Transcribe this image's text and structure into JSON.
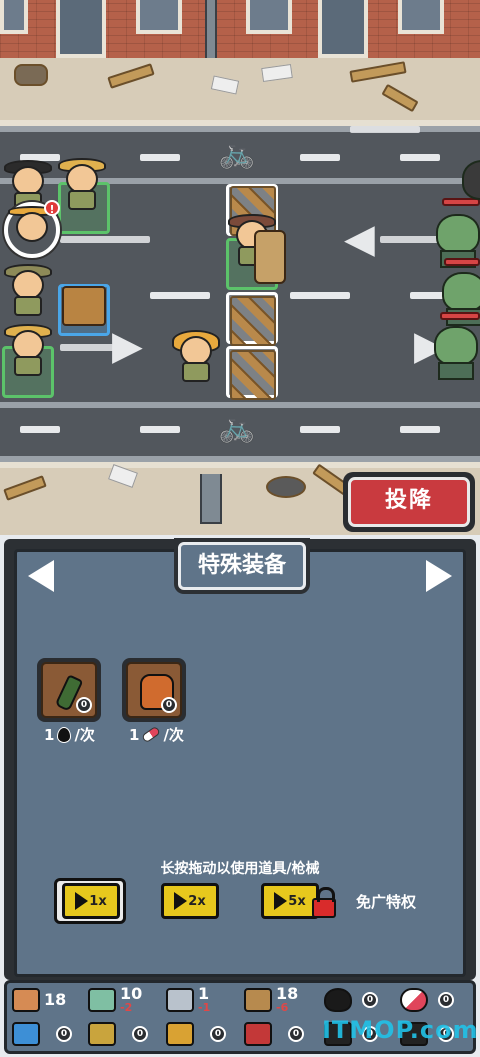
{
  "battle": {
    "surrender_label": "投降"
  },
  "panel": {
    "title": "特殊装备",
    "items": [
      {
        "name": "molotov-bottle",
        "count": "0",
        "cost_amount": "1",
        "cost_unit": "/次",
        "cost_icon": "oil-drop-icon"
      },
      {
        "name": "explosive-backpack",
        "count": "0",
        "cost_amount": "1",
        "cost_unit": "/次",
        "cost_icon": "pill-capsule-icon"
      }
    ],
    "hint": "长按拖动以使用道具/枪械",
    "speed_buttons": [
      {
        "label": "1x",
        "selected": true
      },
      {
        "label": "2x",
        "selected": false
      },
      {
        "label": "5x",
        "locked": true
      }
    ],
    "ad_free_label": "免广特权"
  },
  "resources": {
    "row1": [
      {
        "icon": "meat-icon",
        "value": "18",
        "delta": "",
        "color": "#d68b54"
      },
      {
        "icon": "cloth-bandage-icon",
        "value": "10",
        "delta": "-2",
        "color": "#7fbfa3"
      },
      {
        "icon": "metal-ingot-icon",
        "value": "1",
        "delta": "-1",
        "color": "#b9c2cc"
      },
      {
        "icon": "wood-plank-icon",
        "value": "18",
        "delta": "-6",
        "color": "#b78a4e"
      },
      {
        "icon": "oil-drop-icon",
        "value": "0",
        "delta": "",
        "color": "#1a1a1a"
      },
      {
        "icon": "pill-capsule-icon",
        "value": "0",
        "delta": "",
        "color": "#e0455b"
      }
    ],
    "row2": [
      {
        "icon": "water-can-icon",
        "value": "0",
        "color": "#3d8fd6"
      },
      {
        "icon": "rifle-ammo-icon",
        "value": "0",
        "color": "#c9a43d"
      },
      {
        "icon": "shotgun-shells-icon",
        "value": "0",
        "color": "#d9a233"
      },
      {
        "icon": "red-shells-icon",
        "value": "0",
        "color": "#c33838"
      },
      {
        "icon": "gear-parts-icon",
        "value": "0",
        "color": "#222222"
      },
      {
        "icon": "gear-parts-icon-2",
        "value": "0",
        "color": "#222222"
      }
    ]
  },
  "watermark": "ITMOP.com"
}
